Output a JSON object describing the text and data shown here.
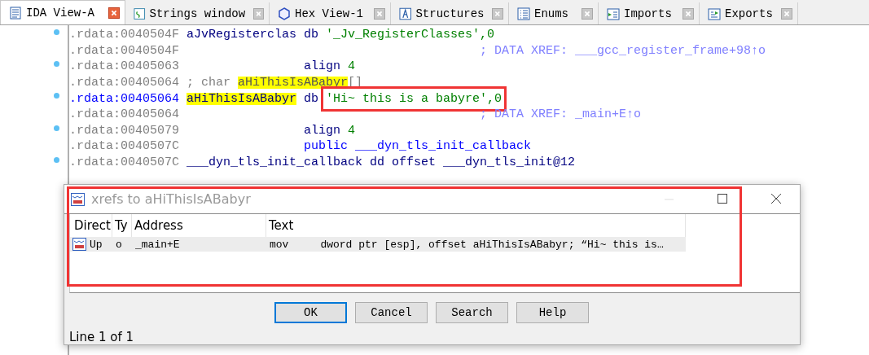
{
  "tabs": [
    {
      "label": "IDA View-A",
      "kind": "disasm",
      "selected": true
    },
    {
      "label": "Strings window",
      "kind": "strings",
      "selected": false
    },
    {
      "label": "Hex View-1",
      "kind": "hex",
      "selected": false
    },
    {
      "label": "Structures",
      "kind": "structs",
      "selected": false
    },
    {
      "label": "Enums",
      "kind": "enums",
      "selected": false
    },
    {
      "label": "Imports",
      "kind": "imports",
      "selected": false
    },
    {
      "label": "Exports",
      "kind": "exports",
      "selected": false
    }
  ],
  "listing": [
    {
      "address": ".rdata:0040504F",
      "dot": true,
      "current": false,
      "label": [
        {
          "text": "aJvRegisterclas db ",
          "kind": "name"
        },
        {
          "text": "'_Jv_RegisterClasses',0",
          "kind": "string"
        }
      ]
    },
    {
      "address": ".rdata:0040504F",
      "dot": false,
      "current": false,
      "comment": "; DATA XREF: ___gcc_register_frame+98↑o"
    },
    {
      "address": ".rdata:00405063",
      "dot": true,
      "current": false,
      "instruction": [
        {
          "text": "align ",
          "kind": "name"
        },
        {
          "text": "4",
          "kind": "string"
        }
      ]
    },
    {
      "address": ".rdata:00405064",
      "dot": false,
      "current": false,
      "label": [
        {
          "text": "; char ",
          "kind": "note"
        },
        {
          "text": "aHiThisIsABabyr",
          "kind": "note",
          "highlighted": true
        },
        {
          "text": "[]",
          "kind": "note"
        }
      ]
    },
    {
      "address": ".rdata:00405064",
      "dot": true,
      "current": true,
      "label": [
        {
          "text": "aHiThisIsABabyr",
          "kind": "name",
          "highlighted": true
        },
        {
          "text": " db ",
          "kind": "name"
        },
        {
          "text": "'Hi~ this is a babyre',0",
          "kind": "string",
          "annotated": true
        }
      ]
    },
    {
      "address": ".rdata:00405064",
      "dot": false,
      "current": false,
      "comment": "; DATA XREF: _main+E↑o"
    },
    {
      "address": ".rdata:00405079",
      "dot": true,
      "current": false,
      "instruction": [
        {
          "text": "align ",
          "kind": "name"
        },
        {
          "text": "4",
          "kind": "string"
        }
      ]
    },
    {
      "address": ".rdata:0040507C",
      "dot": false,
      "current": false,
      "instruction": [
        {
          "text": "public ___dyn_tls_init_callback",
          "kind": "public"
        }
      ]
    },
    {
      "address": ".rdata:0040507C",
      "dot": true,
      "current": false,
      "label": [
        {
          "text": "___dyn_tls_init_callback dd offset ___dyn_tls_init@12",
          "kind": "name"
        }
      ]
    }
  ],
  "dialog": {
    "title": "xrefs to aHiThisIsABabyr",
    "columns": [
      "Direct",
      "Ty",
      "Address",
      "Text"
    ],
    "rows": [
      {
        "direction": "Up",
        "type": "o",
        "address": "_main+E",
        "text": "mov     dword ptr [esp], offset aHiThisIsABabyr; “Hi~ this is…",
        "selected": true
      }
    ],
    "buttons": [
      {
        "label": "OK",
        "selected": true
      },
      {
        "label": "Cancel",
        "selected": false
      },
      {
        "label": "Search",
        "selected": false
      },
      {
        "label": "Help",
        "selected": false
      }
    ],
    "status": "Line 1 of 1"
  }
}
